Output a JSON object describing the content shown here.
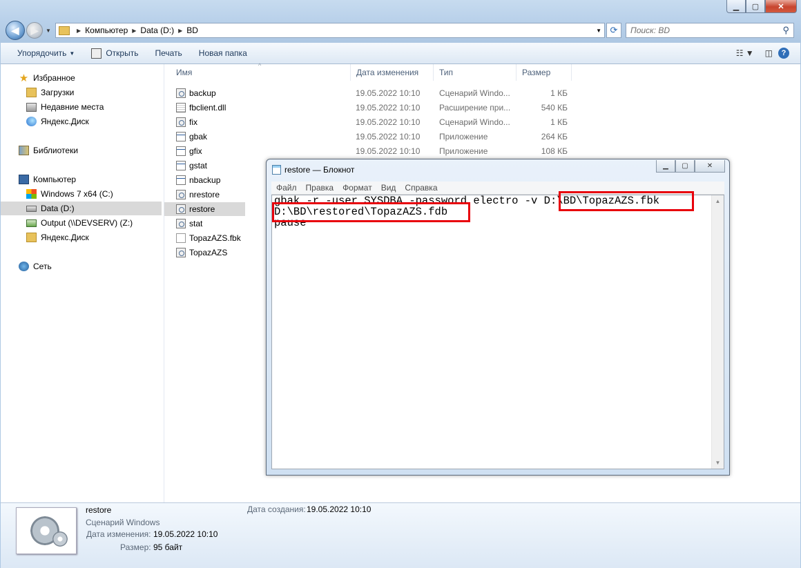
{
  "explorer": {
    "address": {
      "crumbs": [
        "Компьютер",
        "Data (D:)",
        "BD"
      ]
    },
    "search_placeholder": "Поиск: BD",
    "toolbar": {
      "organize": "Упорядочить",
      "open": "Открыть",
      "print": "Печать",
      "new_folder": "Новая папка"
    },
    "nav": {
      "favorites": "Избранное",
      "downloads": "Загрузки",
      "recent": "Недавние места",
      "yadisk": "Яндекс.Диск",
      "libraries": "Библиотеки",
      "computer": "Компьютер",
      "drive_c": "Windows 7 x64 (C:)",
      "drive_d": "Data (D:)",
      "drive_z": "Output (\\\\DEVSERV) (Z:)",
      "yadisk2": "Яндекс.Диск",
      "network": "Сеть"
    },
    "columns": {
      "name": "Имя",
      "date": "Дата изменения",
      "type": "Тип",
      "size": "Размер"
    },
    "files": [
      {
        "name": "backup",
        "date": "19.05.2022 10:10",
        "type": "Сценарий Windo...",
        "size": "1 КБ",
        "icon": "script"
      },
      {
        "name": "fbclient.dll",
        "date": "19.05.2022 10:10",
        "type": "Расширение при...",
        "size": "540 КБ",
        "icon": "dll"
      },
      {
        "name": "fix",
        "date": "19.05.2022 10:10",
        "type": "Сценарий Windo...",
        "size": "1 КБ",
        "icon": "script"
      },
      {
        "name": "gbak",
        "date": "19.05.2022 10:10",
        "type": "Приложение",
        "size": "264 КБ",
        "icon": "exe"
      },
      {
        "name": "gfix",
        "date": "19.05.2022 10:10",
        "type": "Приложение",
        "size": "108 КБ",
        "icon": "exe"
      },
      {
        "name": "gstat",
        "date": "",
        "type": "",
        "size": "",
        "icon": "exe"
      },
      {
        "name": "nbackup",
        "date": "",
        "type": "",
        "size": "",
        "icon": "exe"
      },
      {
        "name": "nrestore",
        "date": "",
        "type": "",
        "size": "",
        "icon": "script"
      },
      {
        "name": "restore",
        "date": "",
        "type": "",
        "size": "",
        "icon": "script"
      },
      {
        "name": "stat",
        "date": "",
        "type": "",
        "size": "",
        "icon": "script"
      },
      {
        "name": "TopazAZS.fbk",
        "date": "",
        "type": "",
        "size": "",
        "icon": "doc"
      },
      {
        "name": "TopazAZS",
        "date": "",
        "type": "",
        "size": "",
        "icon": "script"
      }
    ],
    "selected_file": "restore",
    "details": {
      "name": "restore",
      "type": "Сценарий Windows",
      "modified_label": "Дата изменения:",
      "modified_value": "19.05.2022 10:10",
      "size_label": "Размер:",
      "size_value": "95 байт",
      "created_label": "Дата создания:",
      "created_value": "19.05.2022 10:10"
    }
  },
  "notepad": {
    "title": "restore — Блокнот",
    "menu": [
      "Файл",
      "Правка",
      "Формат",
      "Вид",
      "Справка"
    ],
    "lines": [
      "gbak -r -user SYSDBA -password electro -v D:\\BD\\TopazAZS.fbk",
      "D:\\BD\\restored\\TopazAZS.fdb",
      "pause"
    ]
  },
  "colors": {
    "highlight": "#e8000b",
    "selected_row": "#d9d9d9"
  }
}
